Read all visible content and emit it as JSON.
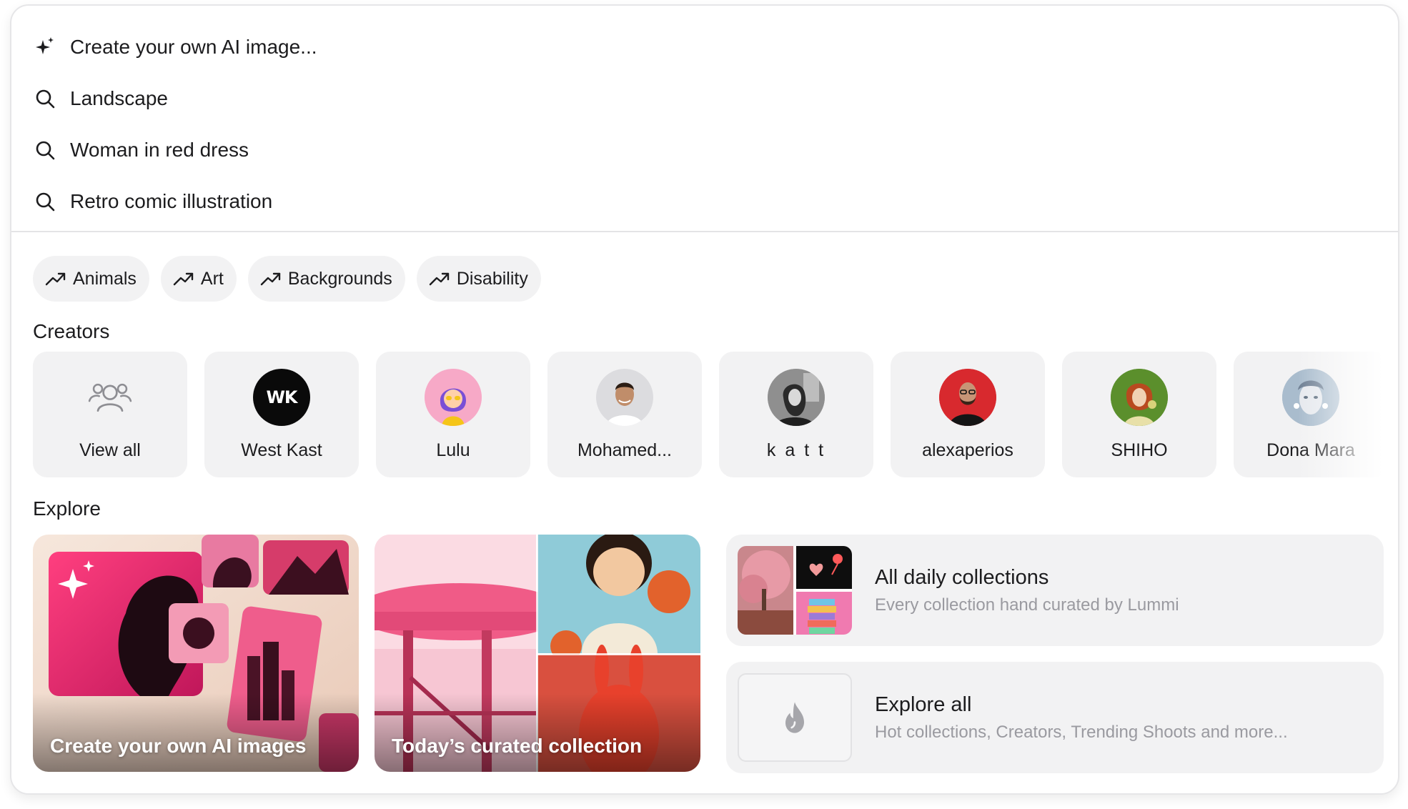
{
  "suggestions": [
    {
      "label": "Create your own AI image...",
      "icon": "sparkle-icon"
    },
    {
      "label": "Landscape",
      "icon": "search-icon"
    },
    {
      "label": "Woman in red dress",
      "icon": "search-icon"
    },
    {
      "label": "Retro comic illustration",
      "icon": "search-icon"
    }
  ],
  "chips": [
    {
      "label": "Animals",
      "icon": "trending-icon"
    },
    {
      "label": "Art",
      "icon": "trending-icon"
    },
    {
      "label": "Backgrounds",
      "icon": "trending-icon"
    },
    {
      "label": "Disability",
      "icon": "trending-icon"
    }
  ],
  "creators_title": "Creators",
  "creators": [
    {
      "name": "View all"
    },
    {
      "name": "West Kast",
      "avatar_text": "WK"
    },
    {
      "name": "Lulu"
    },
    {
      "name": "Mohamed..."
    },
    {
      "name": "k a t t"
    },
    {
      "name": "alexaperios"
    },
    {
      "name": "SHIHO"
    },
    {
      "name": "Dona Mara"
    }
  ],
  "explore_title": "Explore",
  "explore": {
    "create_tile": "Create your own AI images",
    "curated_tile": "Today’s curated collection",
    "daily": {
      "title": "All daily collections",
      "subtitle": "Every collection hand curated by Lummi"
    },
    "all": {
      "title": "Explore all",
      "subtitle": "Hot collections, Creators, Trending Shoots and more..."
    }
  },
  "colors": {
    "chip_bg": "#f2f2f3",
    "text": "#1c1c1e",
    "muted": "#9a9aa0",
    "accent_pink": "#ec3f7d"
  }
}
